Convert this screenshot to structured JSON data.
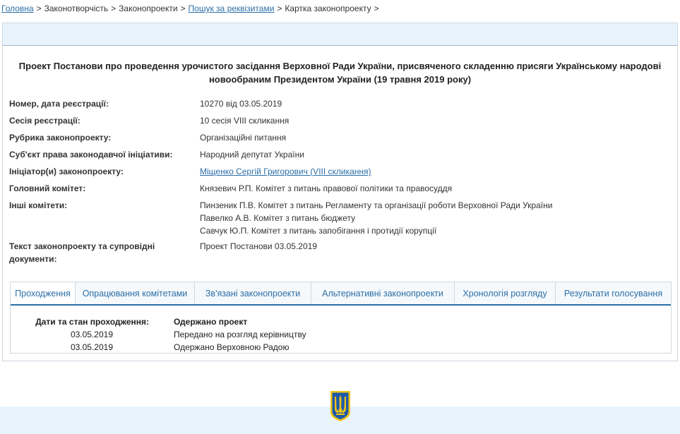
{
  "breadcrumb": {
    "items": [
      {
        "label": "Головна",
        "link": true
      },
      {
        "label": "Законотворчість",
        "link": false
      },
      {
        "label": "Законопроекти",
        "link": false
      },
      {
        "label": "Пошук за реквізитами",
        "link": true
      },
      {
        "label": "Картка законопроекту",
        "link": false
      }
    ],
    "separator": ">"
  },
  "bill": {
    "title": "Проект Постанови про проведення урочистого засідання Верховної Ради України, присвяченого складенню присяги Українському народові новообраним Президентом України (19 травня 2019 року)"
  },
  "properties": {
    "reg_label": "Номер, дата реєстрації:",
    "reg_value": "10270 від 03.05.2019",
    "session_label": "Сесія реєстрації:",
    "session_value": "10 сесія VIII скликання",
    "rubric_label": "Рубрика законопроекту:",
    "rubric_value": "Організаційні питання",
    "subject_label": "Суб'єкт права законодавчої ініціативи:",
    "subject_value": "Народний депутат України",
    "initiator_label": "Ініціатор(и) законопроекту:",
    "initiator_value": "Міщенко Сергій Григорович (VIII скликання)",
    "main_committee_label": "Головний комітет:",
    "main_committee_value": "Князевич Р.П. Комітет з питань правової політики та правосуддя",
    "other_committees_label": "Інші комітети:",
    "other_committees": [
      "Пинзеник П.В. Комітет з питань Регламенту та організації роботи Верховної Ради України",
      "Павелко А.В. Комітет з питань бюджету",
      "Савчук Ю.П. Комітет з питань запобігання і протидії корупції"
    ],
    "docs_label_line1": "Текст законопроекту та супровідні",
    "docs_label_line2": "документи:",
    "docs_value": "Проект Постанови 03.05.2019"
  },
  "tabs": [
    {
      "label": "Проходження",
      "active": true
    },
    {
      "label": "Опрацювання комітетами",
      "active": false
    },
    {
      "label": "Зв'язані законопроекти",
      "active": false
    },
    {
      "label": "Альтернативні законопроекти",
      "active": false
    },
    {
      "label": "Хронологія розгляду",
      "active": false
    },
    {
      "label": "Результати голосування",
      "active": false
    }
  ],
  "passage": {
    "header_label": "Дати та стан проходження:",
    "header_status": "Одержано проект",
    "entries": [
      {
        "date": "03.05.2019",
        "status": "Передано на розгляд керівництву"
      },
      {
        "date": "03.05.2019",
        "status": "Одержано Верховною Радою"
      }
    ]
  },
  "colors": {
    "accent": "#2b6ea6",
    "band": "#e9f3fb",
    "emblem_gold": "#f2c418",
    "emblem_blue": "#1e5aa8"
  },
  "icons": {
    "emblem": "ukraine-trident-emblem-icon"
  }
}
